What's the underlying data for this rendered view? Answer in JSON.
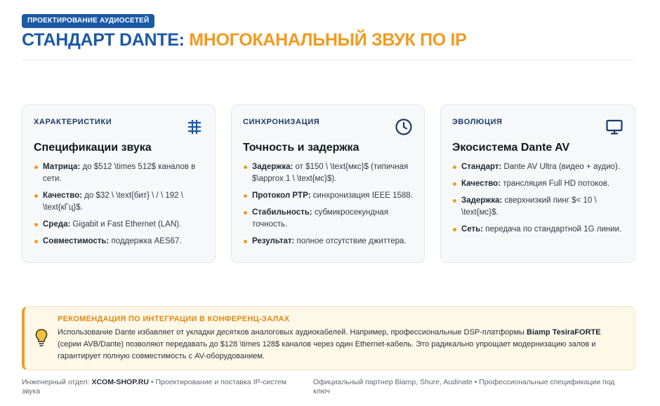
{
  "header": {
    "badge": "Проектирование аудиосетей",
    "title_part1": "Стандарт Dante:",
    "title_part2": "Многоканальный звук по IP"
  },
  "cards": [
    {
      "category": "Характеристики",
      "icon": "table-grid-icon",
      "title": "Спецификации звука",
      "items": [
        {
          "label": "Матрица:",
          "text": "до $512 \\times 512$ каналов в сети."
        },
        {
          "label": "Качество:",
          "text": "до $32 \\ \\text{бит} \\ / \\ 192 \\ \\text{кГц}$."
        },
        {
          "label": "Среда:",
          "text": "Gigabit и Fast Ethernet (LAN)."
        },
        {
          "label": "Совместимость:",
          "text": "поддержка AES67."
        }
      ]
    },
    {
      "category": "Синхронизация",
      "icon": "clock-icon",
      "title": "Точность и задержка",
      "items": [
        {
          "label": "Задержка:",
          "text": "от $150 \\ \\text{мкс}$ (типичная $\\approx 1 \\ \\text{мс}$)."
        },
        {
          "label": "Протокол PTP:",
          "text": "синхронизация IEEE 1588."
        },
        {
          "label": "Стабильность:",
          "text": "субмикросекундная точность."
        },
        {
          "label": "Результат:",
          "text": "полное отсутствие джиттера."
        }
      ]
    },
    {
      "category": "Эволюция",
      "icon": "monitor-icon",
      "title": "Экосистема Dante AV",
      "items": [
        {
          "label": "Стандарт:",
          "text": "Dante AV Ultra (видео + аудио)."
        },
        {
          "label": "Качество:",
          "text": "трансляция Full HD потоков."
        },
        {
          "label": "Задержка:",
          "text": "сверхнизкий пинг $< 10 \\ \\text{мс}$."
        },
        {
          "label": "Сеть:",
          "text": "передача по стандартной 1G линии."
        }
      ]
    }
  ],
  "recommendation": {
    "icon": "lightbulb-icon",
    "title": "Рекомендация по интеграции в конференц-залах",
    "text_before": "Использование Dante избавляет от укладки десятков аналоговых аудиокабелей. Например, профессиональные DSP-платформы ",
    "text_bold": "Biamp TesiraFORTE",
    "text_after": " (серии AVB/Dante) позволяют передавать до $128 \\times 128$ каналов через один Ethernet-кабель. Это радикально упрощает модернизацию залов и гарантирует полную совместимость с AV-оборудованием."
  },
  "footer": {
    "left_prefix": "Инженерный отдел: ",
    "left_bold": "XCOM-SHOP.RU",
    "left_suffix": " • Проектирование и поставка IP-систем звука",
    "right": "Официальный партнер Biamp, Shure, Audinate • Профессиональные спецификации под ключ"
  },
  "colors": {
    "primary": "#1b5aa6",
    "accent": "#f29a1f",
    "card_bg": "#f7f8fa",
    "rec_bg": "#fef8e9"
  }
}
